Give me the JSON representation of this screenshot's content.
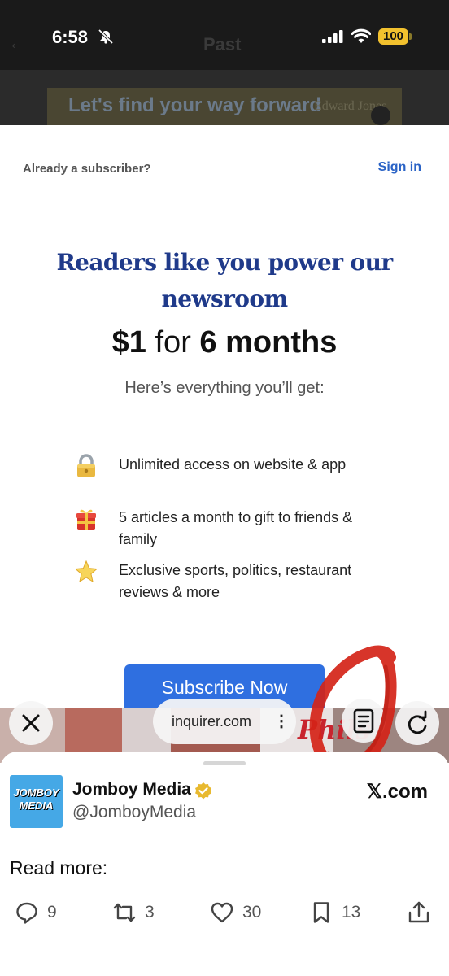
{
  "status_bar": {
    "time": "6:58",
    "battery": "100"
  },
  "background_page": {
    "title": "Past",
    "ad_text": "Let's find your way forward",
    "ad_brand": "Edward Jones"
  },
  "paywall": {
    "already_subscriber": "Already a subscriber?",
    "sign_in": "Sign in",
    "headline": "Readers like you power our newsroom",
    "price_amount": "$1",
    "price_for": "for",
    "price_term": "6 months",
    "everything": "Here’s everything you’ll get:",
    "benefits": [
      {
        "icon": "lock-icon",
        "text": "Unlimited access on website & app"
      },
      {
        "icon": "gift-icon",
        "text": "5 articles a month to gift to friends & family"
      },
      {
        "icon": "star-icon",
        "text": "Exclusive sports, politics, restaurant reviews & more"
      }
    ],
    "subscribe_button": "Subscribe Now"
  },
  "browser": {
    "url": "inquirer.com",
    "kebab": "⋮",
    "bg_text": "Phils"
  },
  "tweet_sheet": {
    "avatar_text": "JOMBOY MEDIA",
    "account_name": "Jomboy Media",
    "handle": "@JomboyMedia",
    "source": "𝕏.com",
    "body": "Read more:",
    "actions": {
      "replies": "9",
      "reposts": "3",
      "likes": "30",
      "bookmarks": "13"
    }
  },
  "colors": {
    "headline_blue": "#1f3a8a",
    "button_blue": "#2f6fe0",
    "link_blue": "#2a63c6",
    "annotation_red": "#d42418",
    "battery_yellow": "#f2c12e"
  }
}
